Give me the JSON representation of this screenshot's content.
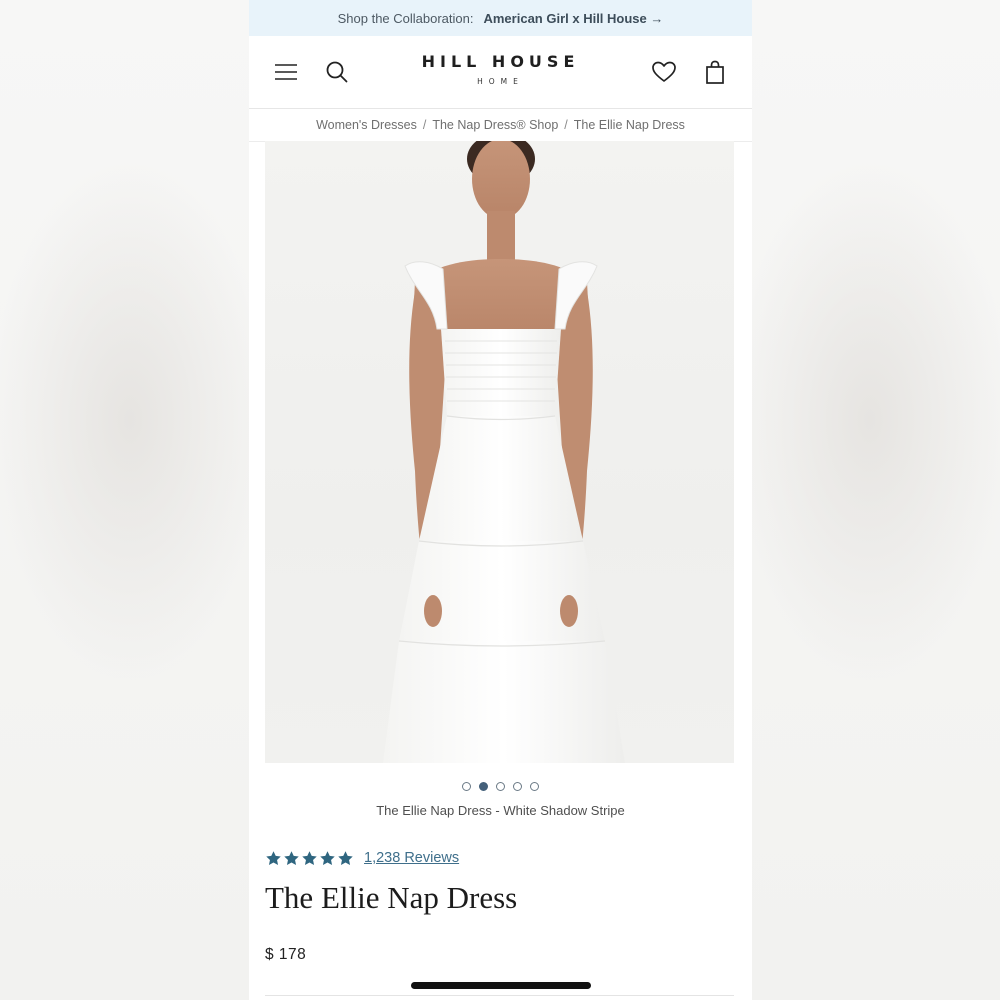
{
  "promo": {
    "prefix": "Shop the Collaboration:",
    "link": "American Girl x Hill House →"
  },
  "header": {
    "logo_main": "HILL HOUSE",
    "logo_sub": "HOME",
    "icons": [
      "menu-icon",
      "search-icon",
      "heart-icon",
      "bag-icon"
    ]
  },
  "breadcrumb": {
    "items": [
      "Women's Dresses",
      "The Nap Dress® Shop",
      "The Ellie Nap Dress"
    ],
    "separator": "/"
  },
  "gallery": {
    "total_images": 5,
    "active_index": 1,
    "caption": "The Ellie Nap Dress - White Shadow Stripe"
  },
  "product": {
    "rating": 5,
    "reviews_label": "1,238 Reviews",
    "title": "The Ellie Nap Dress",
    "price": "$ 178"
  },
  "colors": {
    "promo_bg": "#e8f3fa",
    "accent": "#2f6680",
    "link": "#3f6f8b",
    "dot_active": "#44607a"
  }
}
